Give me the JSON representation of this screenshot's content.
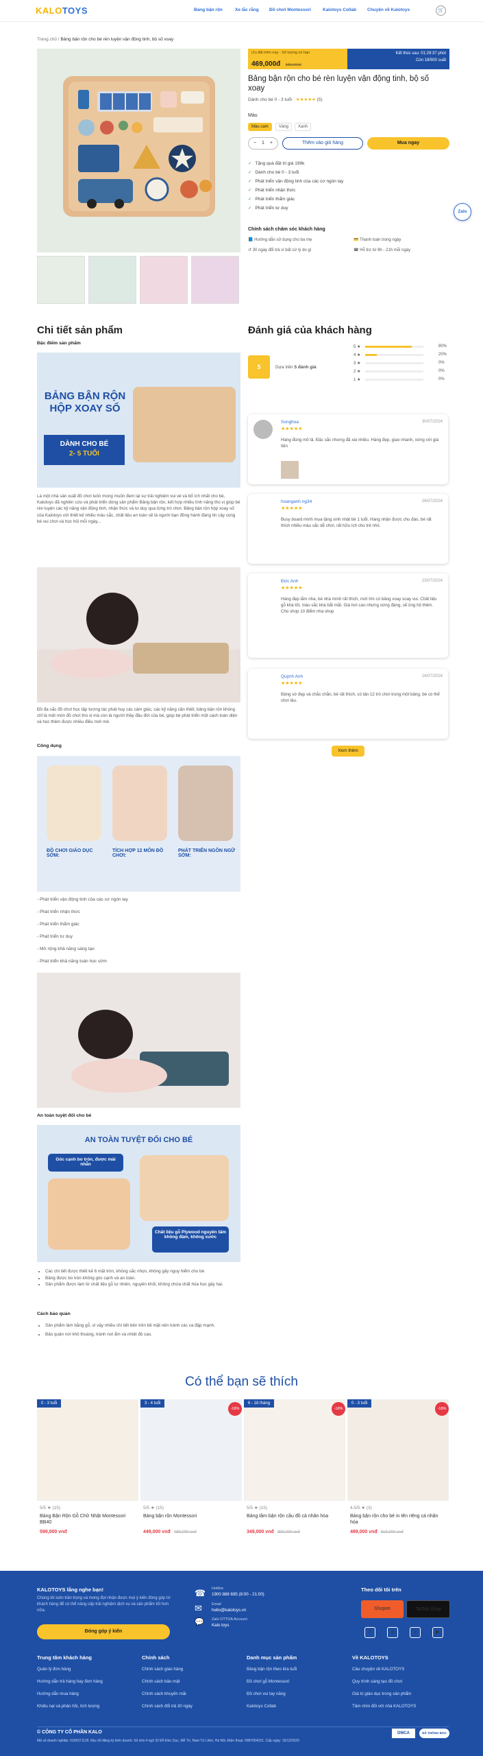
{
  "header": {
    "logo_a": "KALO",
    "logo_b": "TOYS",
    "nav": [
      "Bảng bận rộn",
      "Xe lắc rắng",
      "Đồ chơi Montessori",
      "Kalotoys Collab",
      "Chuyện về Kalotoys"
    ]
  },
  "breadcrumb": {
    "home": "Trang chủ",
    "sep": "/",
    "current": "Bảng bận rộn cho bé rèn luyện vận động tinh, bộ số xoay"
  },
  "price_bar": {
    "label": "Ưu đãi hôm nay - Số lượng có hạn",
    "price": "469,000đ",
    "old_price": "589,000đ",
    "countdown": "Kết thúc sau: 01:29:37 phút",
    "stock": "Còn 18/500 suất"
  },
  "product": {
    "title": "Bảng bận rộn cho bé rèn luyện vận động tinh, bộ số xoay",
    "subtitle": "Dành cho bé 0 - 3 tuổi",
    "rating_stars": "★★★★★",
    "rating_count": "(5)",
    "color_label": "Màu",
    "colors": [
      "Màu cam",
      "Vàng",
      "Xanh"
    ],
    "qty_minus": "−",
    "qty": "1",
    "qty_plus": "+",
    "add_to_cart": "Thêm vào giỏ hàng",
    "buy_now": "Mua ngay",
    "features": [
      "Tặng quà đặt trị giá 199k",
      "Dành cho bé 0 - 3 tuổi",
      "Phát triển vận động tinh của các cơ ngón tay",
      "Phát triển nhận thức",
      "Phát triển thẩm giác",
      "Phát triển tư duy"
    ],
    "check_icon": "✓",
    "policy_title": "Chính sách chăm sóc khách hàng",
    "policies": [
      "Hướng dẫn sử dụng cho ba mẹ",
      "Thanh toán trong ngày",
      "30 ngày đổi trả vì bất cứ lý do gì",
      "Hỗ trợ từ 8h - 21h mỗi ngày"
    ]
  },
  "zalo": "Zalo",
  "detail": {
    "heading": "Chi tiết sản phẩm",
    "features_heading": "Đặc điểm sản phẩm",
    "banner1_line1": "BẢNG BẬN RỘN",
    "banner1_line2": "HỘP XOAY SỐ",
    "banner1_line3": "DÀNH CHO BÉ",
    "banner1_line4": "2- 5 TUỔI",
    "para1": "Là một nhà sản xuất đồ chơi luôn mong muốn đem lại sự trải nghiệm vui vẻ và bổ ích nhất cho bé, Kalotoys đã nghiên cứu và phát triển dòng sản phẩm Bảng bận rộn, kết hợp nhiều tính năng thú vị giúp bé rèn luyện các kỹ năng vận động tinh, nhận thức và tư duy qua từng trò chơi. Bảng bận rộn hộp xoay số của Kalotoys với thiết kế nhiều màu sắc, chất liệu an toàn sẽ là người bạn đồng hành đáng tin cậy cùng bé vui chơi và học hỏi mỗi ngày...",
    "para2": "Đồ đa sắc đồ chơi học tập tương tác phát huy các cảm giác, các kỹ năng cần thiết, bảng bận rộn không chỉ là một món đồ chơi thú vị mà còn là người thầy đầu đời của bé, giúp bé phát triển một cách toàn diện và học thêm được nhiều điều mới mẻ.",
    "uses_heading": "Công dụng",
    "banner2": [
      "ĐỒ CHƠI GIÁO DỤC SỚM:",
      "TÍCH HỢP 12 MÔN ĐỒ CHƠI:",
      "PHÁT TRIỂN NGÔN NGỮ SỚM:"
    ],
    "uses": [
      "- Phát triển vận động tinh của các cơ ngón tay",
      "- Phát triển nhận thức",
      "- Phát triển thẩm giác",
      "- Phát triển tư duy",
      "- Mở rộng khả năng sáng tạo",
      "- Phát triển khả năng toán học sớm"
    ],
    "safety_heading": "An toàn tuyệt đối cho bé",
    "banner3_title": "AN TOÀN TUYỆT ĐỐI CHO BÉ",
    "banner3_a": "Góc cạnh bo tròn, được mài nhẵn",
    "banner3_b": "Chất liệu gỗ Plywood nguyên tấm không đàm, không xước",
    "safety_points": [
      "Các chi tiết được thiết kế 6 mặt tròn, không sắc nhọn, không gây nguy hiểm cho bé.",
      "Bảng được bo tròn không góc cạnh và an toàn.",
      "Sản phẩm được làm từ chất liệu gỗ tự nhiên, nguyên khối, không chứa chất hóa học gây hại."
    ],
    "care_heading": "Cách bảo quản",
    "care_points": [
      "Sản phẩm làm bằng gỗ, vì vậy nhiều chi tiết bên trên bề mặt nên tránh các va đập mạnh.",
      "Bảo quản nơi khô thoáng, tránh nơi ẩm và nhiệt độ cao."
    ]
  },
  "reviews": {
    "heading": "Đánh giá của khách hàng",
    "avg": "5",
    "based_on_prefix": "Dựa trên ",
    "based_on_count": "5 đánh giá",
    "dist": [
      {
        "label": "5 ★",
        "pct": "80%",
        "value": 0.8
      },
      {
        "label": "4 ★",
        "pct": "20%",
        "value": 0.2
      },
      {
        "label": "3 ★",
        "pct": "0%",
        "value": 0
      },
      {
        "label": "2 ★",
        "pct": "0%",
        "value": 0
      },
      {
        "label": "1 ★",
        "pct": "0%",
        "value": 0
      }
    ],
    "items": [
      {
        "name": "Songhoa",
        "date": "30/07/2024",
        "stars": "★★★★★",
        "text": "Hàng đúng mô tả. Đặc sắc nhưng đã xài nhiều. Hàng đẹp, giao nhanh, xứng với giá tiền"
      },
      {
        "name": "hoanganh.ng34",
        "date": "26/07/2024",
        "stars": "★★★★★",
        "text": "Busy board mình mua tặng sinh nhật bé 1 tuổi. Hàng nhận được chu đáo, bé rất thích nhiều màu sắc dễ chơi, rất hữu ích cho trẻ nhỏ."
      },
      {
        "name": "Đức Anh",
        "date": "23/07/2024",
        "stars": "★★★★★",
        "text": "Hàng đẹp lắm nha, bé nhà mình rất thích, mới tìm có bảng xoay xoay vui. Chất liệu gỗ khá tốt, màu sắc khá bắt mắt. Giá hơi cao nhưng xứng đáng, sẽ ủng hộ thêm. Cho shop 10 điểm nha shop"
      },
      {
        "name": "Quỳnh Anh",
        "date": "16/07/2024",
        "stars": "★★★★★",
        "text": "Bảng sờ đẹp và chắc chắn, bé rất thích, có tận 12 trò chơi trong một bảng, bé có thể chơi lâu."
      }
    ],
    "see_all": "Xem thêm"
  },
  "related": {
    "heading": "Có thể bạn sẽ thích",
    "items": [
      {
        "age": "0 - 3 tuổi",
        "rating": "5/5 ★ (15)",
        "name": "Bảng Bận Rộn Gỗ Chữ Nhật Montessori BB40",
        "price": "599,000 vnđ",
        "old": "",
        "disc": ""
      },
      {
        "age": "3 - 4 tuổi",
        "rating": "5/5 ★ (15)",
        "name": "Bảng bận rộn Montessori",
        "price": "449,000 vnđ",
        "old": "489,000 vnđ",
        "disc": "-18%"
      },
      {
        "age": "6 - 18 tháng",
        "rating": "5/5 ★ (15)",
        "name": "Bảng tầm bận rộn cầu đồ cả nhân hóa",
        "price": "349,000 vnđ",
        "old": "399,000 vnđ",
        "disc": "-18%"
      },
      {
        "age": "0 - 3 tuổi",
        "rating": "4.5/5 ★ (3)",
        "name": "Bảng bận rộn cho bé in tên riêng cá nhân hóa",
        "price": "489,000 vnđ",
        "old": "619,000 vnđ",
        "disc": "-18%"
      }
    ]
  },
  "footer": {
    "listen_title": "KALOTOYS lắng nghe bạn!",
    "listen_text": "Chúng tôi luôn trân trọng và mong đợi nhận được mọi ý kiến đóng góp từ khách hàng để có thể nâng cấp trải nghiệm dịch vụ và sản phẩm tốt hơn nữa.",
    "consult": "Đóng góp ý kiến",
    "hotline_label": "Hotline",
    "hotline": "1900 888 695 (8:00 - 21:00)",
    "email_label": "Email",
    "email": "hello@kalotoys.vn",
    "zalo_label": "Zalo OTTOA Account",
    "zalo": "Kalo toys",
    "follow_title": "Theo dõi tôi trên",
    "shopee": "Shopee",
    "tiktok": "TikTok Shop",
    "social_icons": [
      "f",
      "◎",
      "♪",
      "▶"
    ],
    "cols": [
      {
        "title": "Trung tâm khách hàng",
        "links": [
          "Quản lý đơn hàng",
          "Hướng dẫn trả hàng hay đơn hàng",
          "Hướng dẫn mua hàng",
          "Khiếu nại và phản hồi, tích lượng"
        ]
      },
      {
        "title": "Chính sách",
        "links": [
          "Chính sách giao hàng",
          "Chính sách bảo mật",
          "Chính sách khuyến mãi",
          "Chính sách đổi trả 30 ngày"
        ]
      },
      {
        "title": "Danh mục sản phẩm",
        "links": [
          "Bảng bận rộn theo lứa tuổi",
          "Đồ chơi gỗ Montessori",
          "Đồ chơi vui tay năng",
          "Kalotoys Collab"
        ]
      },
      {
        "title": "Về KALOTOYS",
        "links": [
          "Câu chuyện về KALOTOYS",
          "Quy trình sáng tạo đồ chơi",
          "Giá trị giáo dục trong sản phẩm",
          "Tầm nhìn đối với nhà KALOTOYS"
        ]
      }
    ],
    "company": "© CÔNG TY CỔ PHẦN KALO",
    "address": "Mã số doanh nghiệp: 0109371126. Địa chỉ đăng ký kinh doanh: Số nhà 4 ngõ 32 Đỗ Đức Dục, Mễ Trì, Nam Từ Liêm, Hà Nội. Điện thoại: 0987654321. Cấp ngày: 15/12/2020",
    "badge1": "DMCA",
    "badge2": "ĐÃ THÔNG BÁO"
  }
}
